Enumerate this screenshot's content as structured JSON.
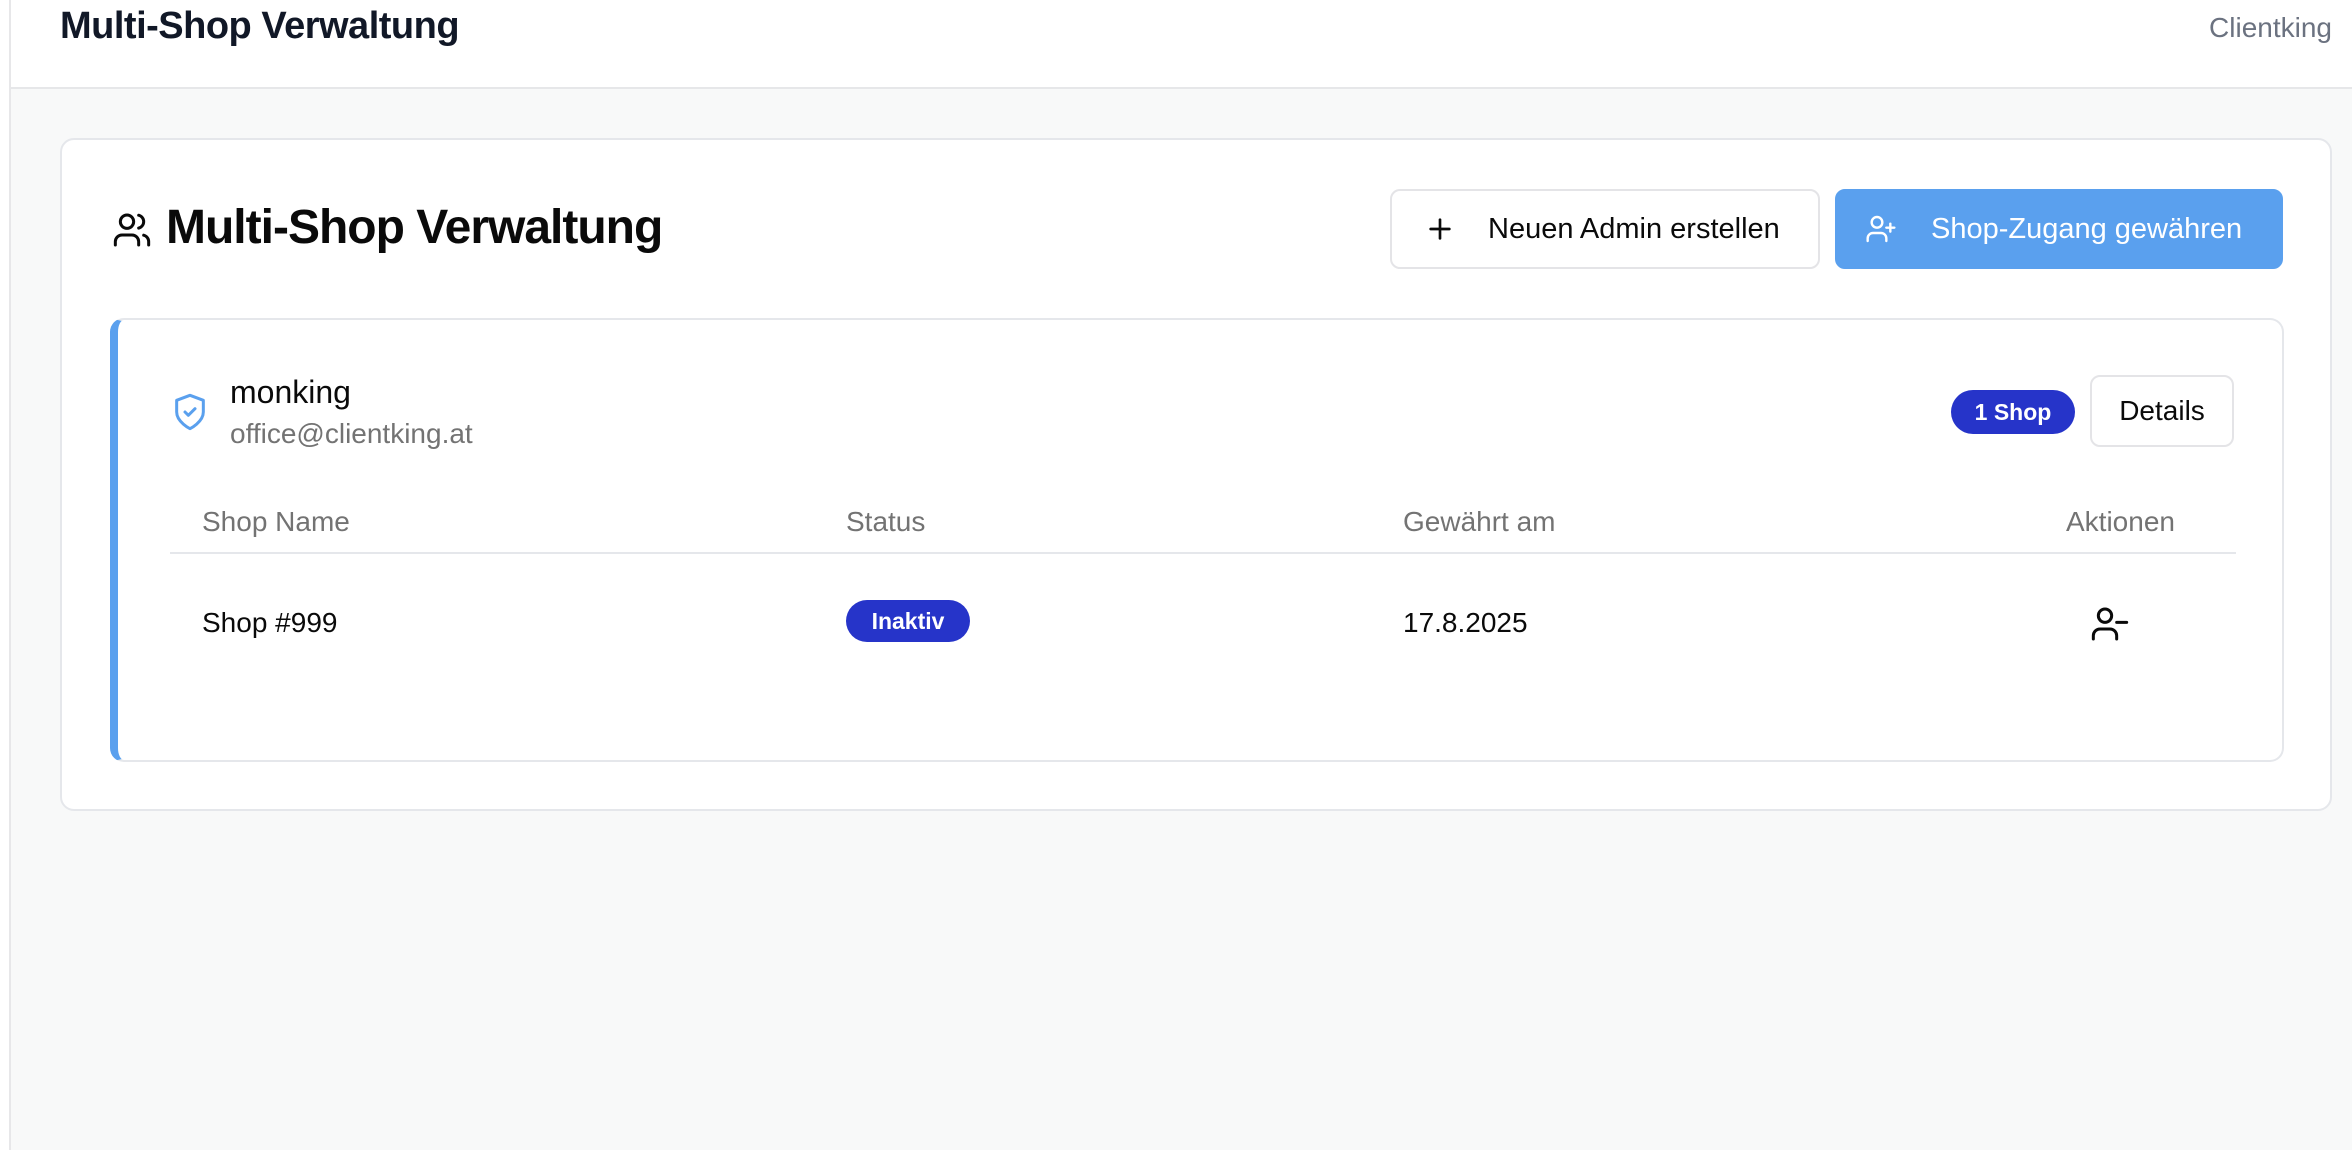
{
  "topbar": {
    "title": "Multi-Shop Verwaltung",
    "user": "Clientking"
  },
  "panel": {
    "title": "Multi-Shop Verwaltung",
    "new_admin_label": "Neuen Admin erstellen",
    "grant_access_label": "Shop-Zugang gewähren"
  },
  "admin": {
    "name": "monking",
    "email": "office@clientking.at",
    "shop_count": "1 Shop",
    "details_label": "Details",
    "table": {
      "headers": [
        "Shop Name",
        "Status",
        "Gewährt am",
        "Aktionen"
      ],
      "rows": [
        {
          "shop_name": "Shop #999",
          "status": "Inaktiv",
          "granted_on": "17.8.2025"
        }
      ]
    }
  },
  "colors": {
    "accent": "#5aa0ee",
    "badge": "#2634c9"
  },
  "icons": {
    "panel": "users-icon",
    "new_admin": "plus-icon",
    "grant_access": "user-plus-icon",
    "admin": "shield-check-icon",
    "remove": "user-minus-icon"
  }
}
